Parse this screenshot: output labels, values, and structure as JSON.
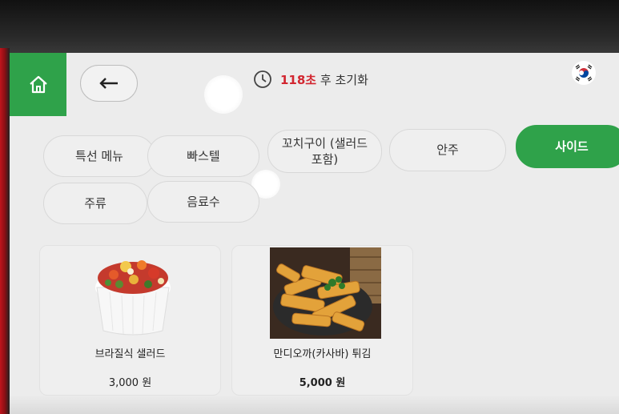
{
  "header": {
    "timer_seconds": "118초",
    "timer_suffix": "후 초기화",
    "language_flag": "korea-flag-icon"
  },
  "categories": [
    {
      "label": "특선 메뉴",
      "active": false
    },
    {
      "label": "빠스텔",
      "active": false
    },
    {
      "label": "꼬치구이 (샐러드\n포함)",
      "active": false
    },
    {
      "label": "안주",
      "active": false
    },
    {
      "label": "사이드",
      "active": true
    },
    {
      "label": "주류",
      "active": false
    },
    {
      "label": "음료수",
      "active": false
    }
  ],
  "products": [
    {
      "name": "브라질식 샐러드",
      "price": "3,000 원"
    },
    {
      "name": "만디오까(카사바) 튀김",
      "price": "5,000 원"
    }
  ],
  "colors": {
    "brand_green": "#2fa24a",
    "timer_red": "#d22630",
    "screen_bg": "#ececec"
  }
}
